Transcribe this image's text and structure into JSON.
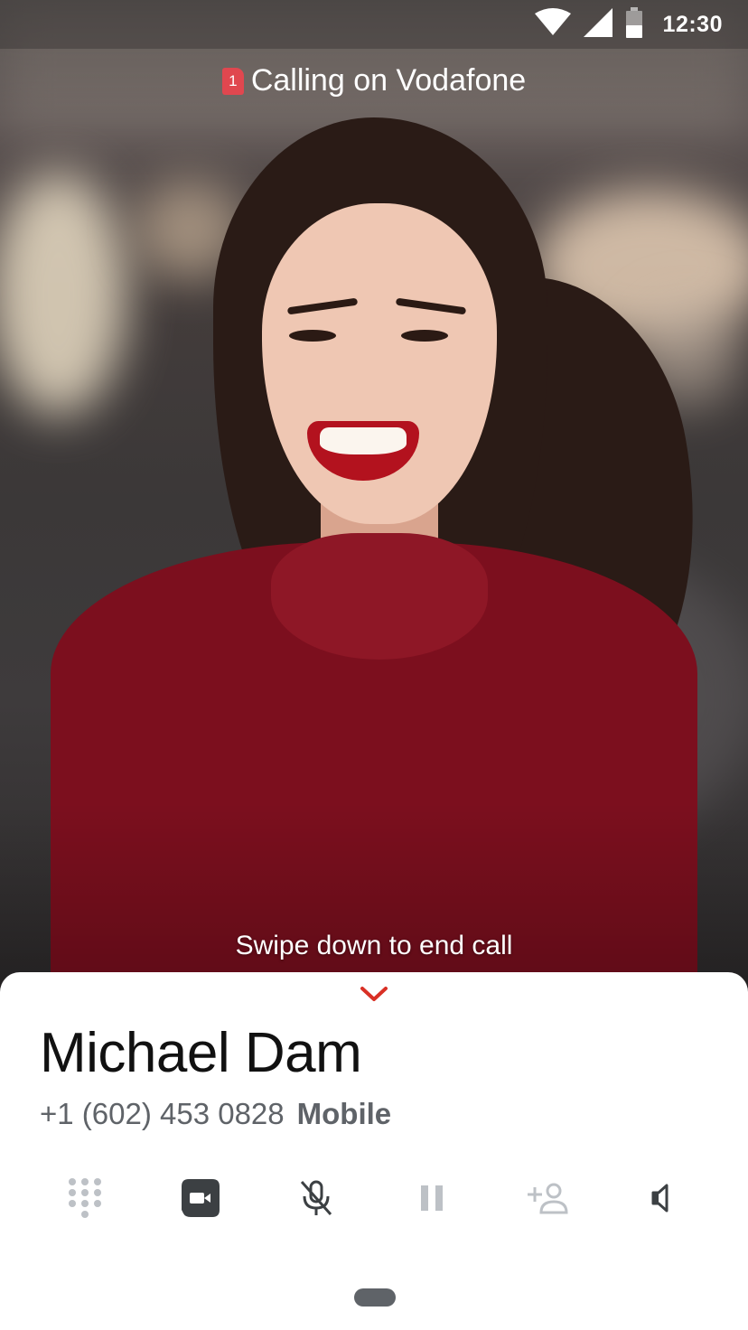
{
  "status_bar": {
    "time": "12:30",
    "icons": [
      "wifi-icon",
      "cell-signal-icon",
      "battery-icon"
    ]
  },
  "call": {
    "sim_slot": "1",
    "carrier_text": "Calling on Vodafone",
    "swipe_hint": "Swipe down to end call"
  },
  "contact": {
    "name": "Michael Dam",
    "phone": "+1 (602) 453 0828",
    "phone_type": "Mobile"
  },
  "actions": [
    {
      "name": "dialpad",
      "icon": "dialpad-icon"
    },
    {
      "name": "video",
      "icon": "video-call-icon"
    },
    {
      "name": "mute",
      "icon": "mic-off-icon"
    },
    {
      "name": "hold",
      "icon": "pause-icon"
    },
    {
      "name": "add-call",
      "icon": "add-person-icon"
    },
    {
      "name": "speaker",
      "icon": "speaker-icon"
    }
  ],
  "colors": {
    "accent": "#d93025",
    "sim_badge": "#e0474f",
    "icon_gray": "#5f6368",
    "icon_dark": "#3c4043",
    "icon_light": "#bdc1c6"
  }
}
